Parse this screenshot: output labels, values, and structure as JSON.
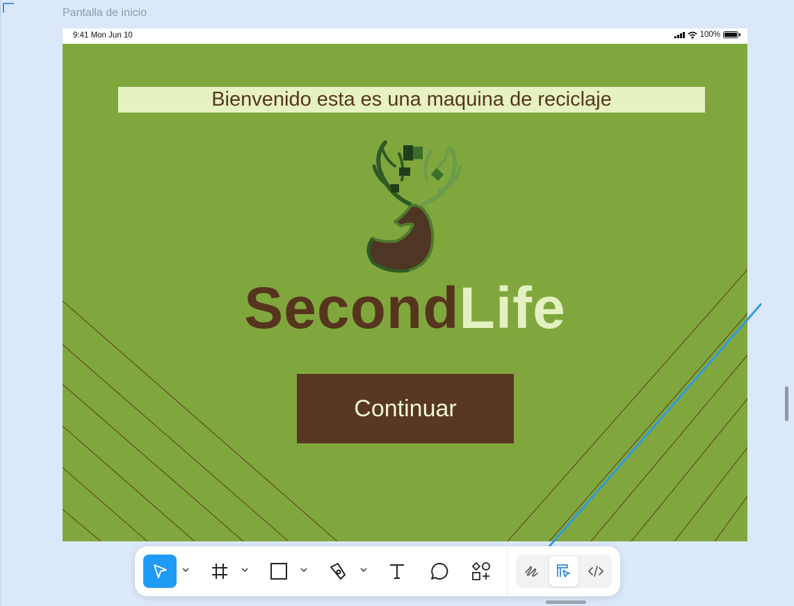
{
  "canvas": {
    "frame_label": "Pantalla de inicio"
  },
  "statusbar": {
    "time": "9:41  Mon Jun 10",
    "battery_text": "100%",
    "battery_level": 1.0
  },
  "screen": {
    "welcome_text": "Bienvenido esta es una maquina de reciclaje",
    "brand_part1": "Second",
    "brand_part2": "Life",
    "continue_label": "Continuar",
    "colors": {
      "background": "#80a73d",
      "brown": "#593725",
      "cream": "#e6f2bf"
    }
  },
  "toolbar": {
    "tools": [
      "move-tool",
      "frame-tool",
      "shape-tool",
      "pen-tool",
      "text-tool",
      "comment-tool",
      "resources-tool"
    ],
    "active_tool": "move-tool",
    "modes": [
      "draw-mode",
      "design-mode",
      "dev-mode"
    ],
    "active_mode": "design-mode"
  }
}
